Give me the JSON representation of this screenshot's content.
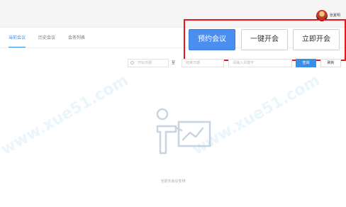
{
  "header": {
    "username": "张夏明"
  },
  "tabs": [
    {
      "label": "当前会议",
      "active": true
    },
    {
      "label": "历史会议",
      "active": false
    },
    {
      "label": "会务列表",
      "active": false
    }
  ],
  "actions": {
    "schedule": "预约会议",
    "one_click": "一键开会",
    "instant": "立即开会"
  },
  "filters": {
    "start_date_placeholder": "开始日期",
    "separator": "至",
    "end_date_placeholder": "结束日期",
    "keyword_placeholder": "请输入关键字",
    "query_label": "查询",
    "reset_label": "刷新"
  },
  "empty": {
    "message": "当前无会议安排"
  },
  "watermark": {
    "text": "www.xue51.com"
  },
  "colors": {
    "accent": "#3a8ee6",
    "highlight": "#e8151b",
    "primary_button": "#4a8ef0"
  }
}
